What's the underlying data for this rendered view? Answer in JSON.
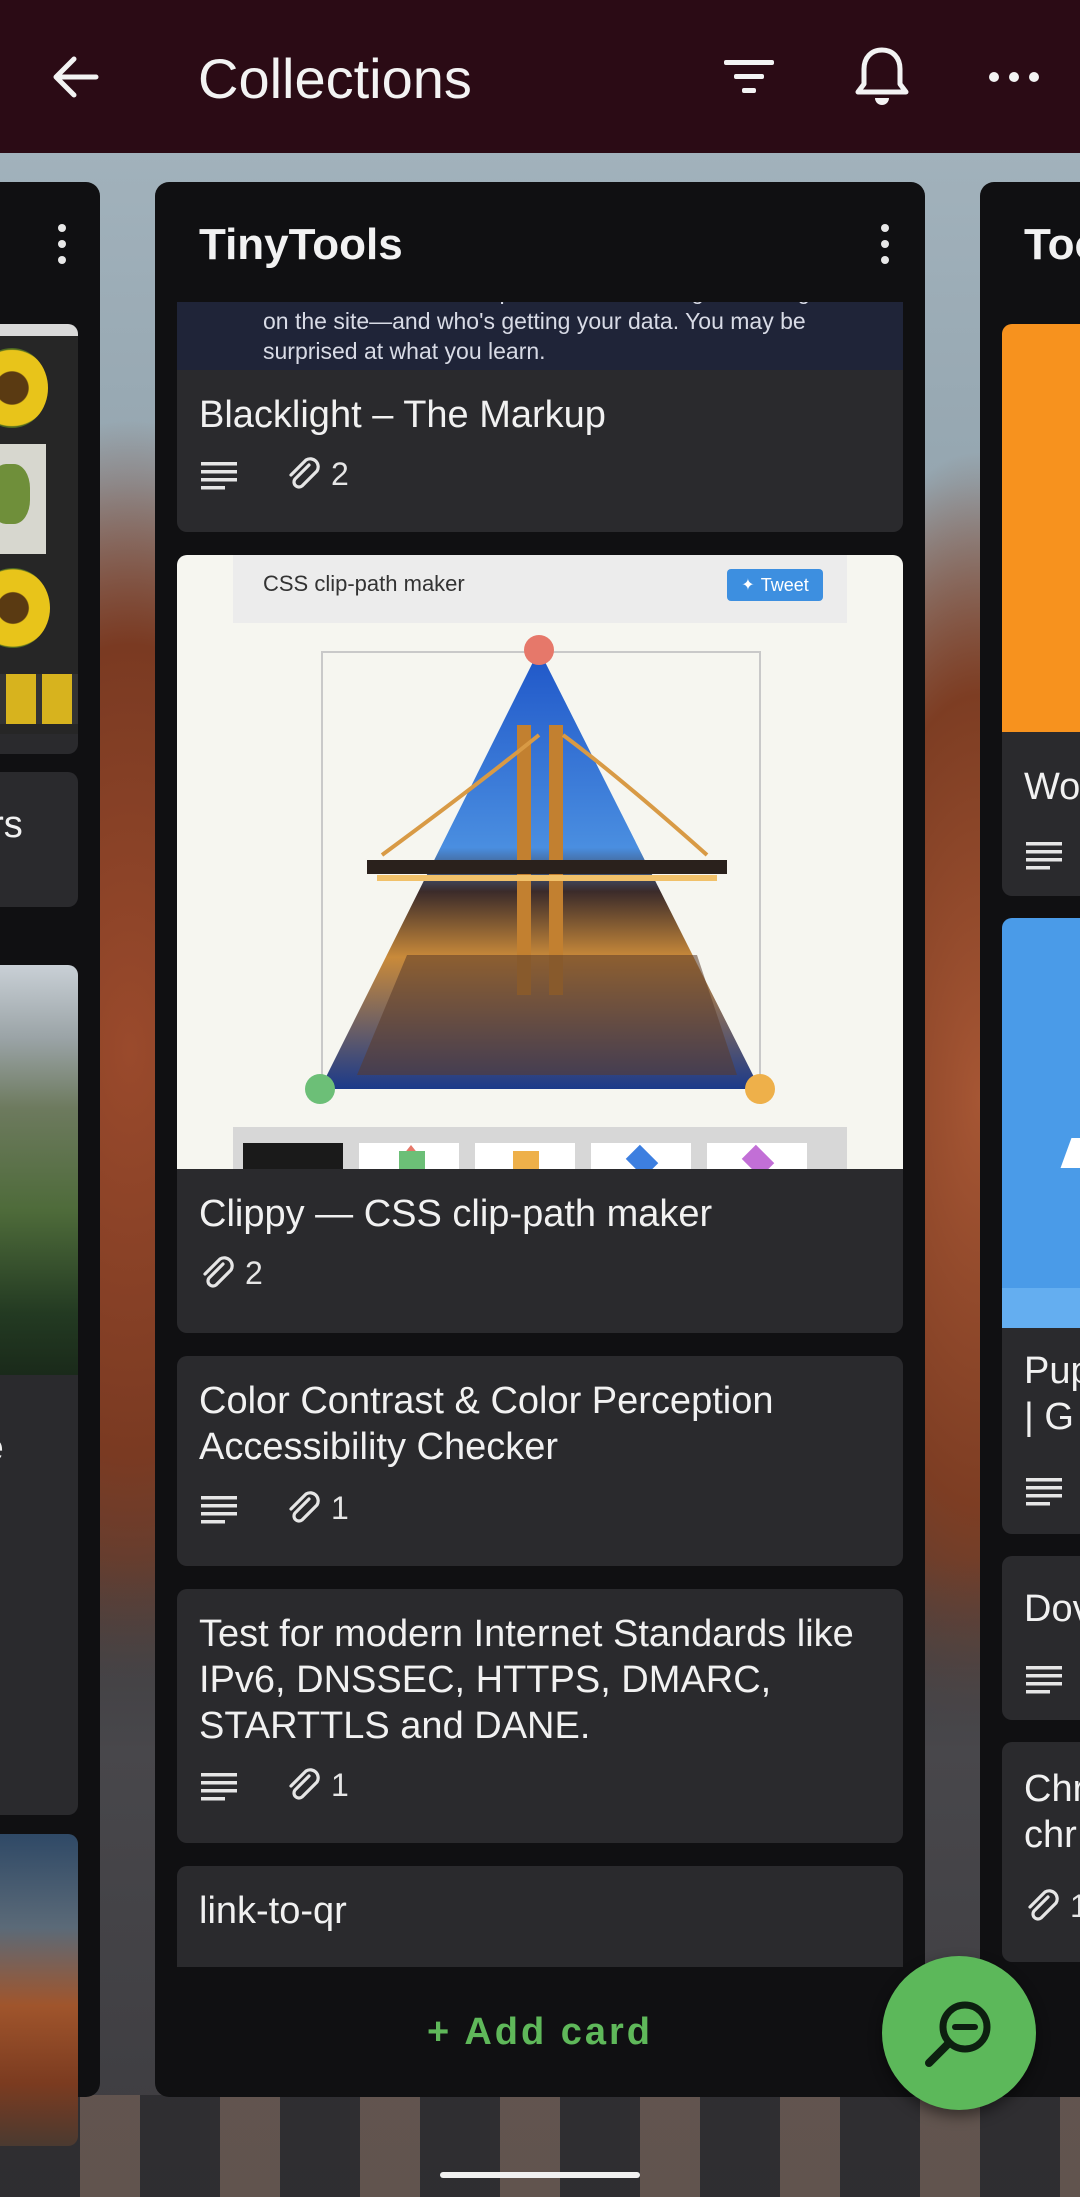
{
  "app_bar": {
    "title": "Collections",
    "icons": [
      "arrow-back-icon",
      "filter-icon",
      "bell-icon",
      "more-horizontal-icon"
    ],
    "background": "#2b0b15"
  },
  "left_list": {
    "card_fragments": [
      "ers",
      "re"
    ]
  },
  "main_list": {
    "title": "TinyTools",
    "cards": [
      {
        "preview_text": "scan it and reveal the specific user-tracking technologies on the site—and who's getting your data. You may be surprised at what you learn.",
        "title": "Blacklight – The Markup",
        "attachments": "2"
      },
      {
        "preview_header": "CSS clip-path maker",
        "preview_tweet_label": "Tweet",
        "title": "Clippy — CSS clip-path maker",
        "attachments": "2"
      },
      {
        "title": "Color Contrast & Color Perception Accessibility Checker",
        "attachments": "1"
      },
      {
        "title": "Test for modern Internet Standards like IPv6, DNSSEC, HTTPS, DMARC, STARTTLS and DANE.",
        "attachments": "1"
      },
      {
        "title": "link-to-qr"
      }
    ],
    "add_card_label": "+ Add card"
  },
  "right_list": {
    "title_fragment": "Too",
    "card_fragments": [
      "Wo",
      "Pup",
      "| G",
      "Dov",
      "Chr",
      "chr",
      "1"
    ]
  },
  "colors": {
    "list_bg": "#101012",
    "card_bg": "#2a2a2d",
    "accent_green": "#5cb85a",
    "add_card_text": "#5fb85a"
  }
}
